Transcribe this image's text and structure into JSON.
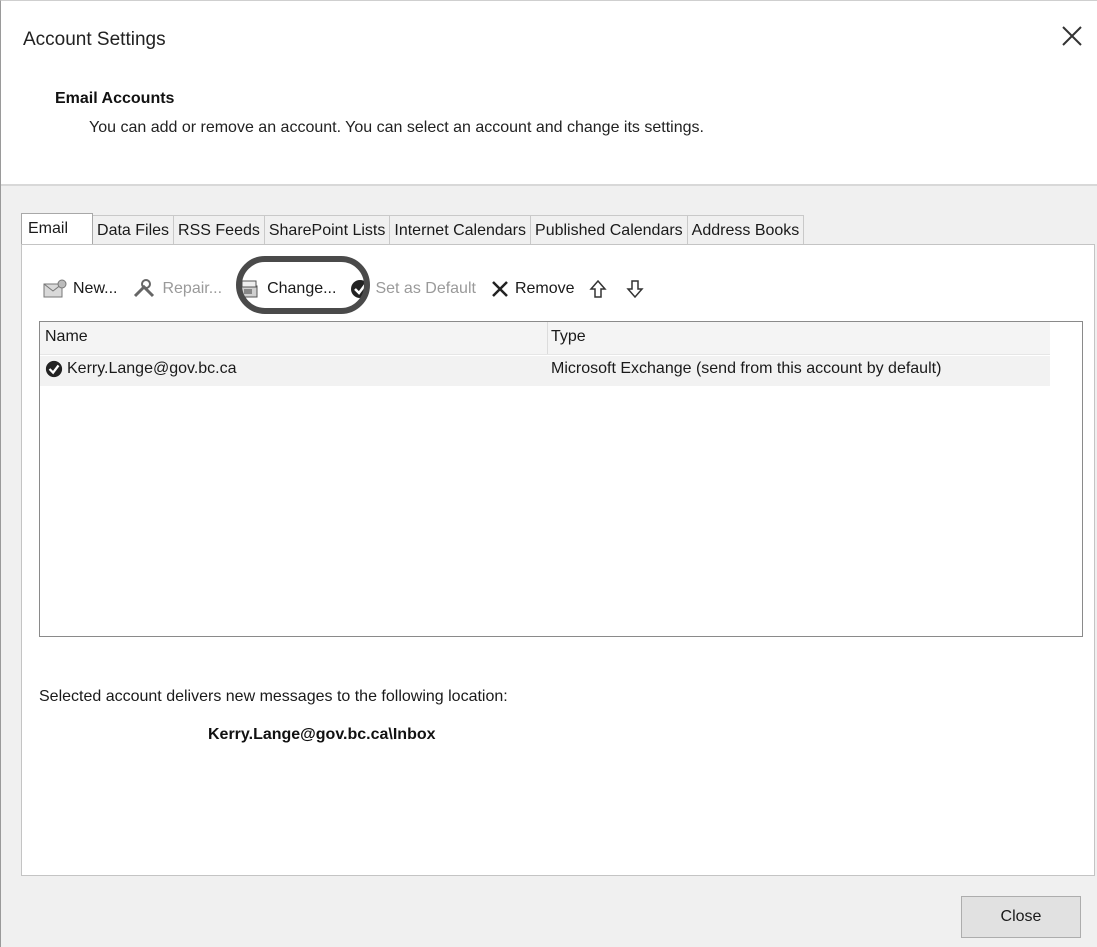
{
  "window": {
    "title": "Account Settings"
  },
  "header": {
    "heading": "Email Accounts",
    "description": "You can add or remove an account. You can select an account and change its settings."
  },
  "tabs": [
    {
      "label": "Email",
      "active": true
    },
    {
      "label": "Data Files"
    },
    {
      "label": "RSS Feeds"
    },
    {
      "label": "SharePoint Lists"
    },
    {
      "label": "Internet Calendars"
    },
    {
      "label": "Published Calendars"
    },
    {
      "label": "Address Books"
    }
  ],
  "toolbar": {
    "new_label": "New...",
    "repair_label": "Repair...",
    "change_label": "Change...",
    "set_default_label": "Set as Default",
    "remove_label": "Remove"
  },
  "list": {
    "columns": {
      "name": "Name",
      "type": "Type"
    },
    "rows": [
      {
        "name": "Kerry.Lange@gov.bc.ca",
        "type": "Microsoft Exchange (send from this account by default)"
      }
    ]
  },
  "delivery": {
    "label": "Selected account delivers new messages to the following location:",
    "path": "Kerry.Lange@gov.bc.ca\\Inbox"
  },
  "buttons": {
    "close": "Close"
  }
}
